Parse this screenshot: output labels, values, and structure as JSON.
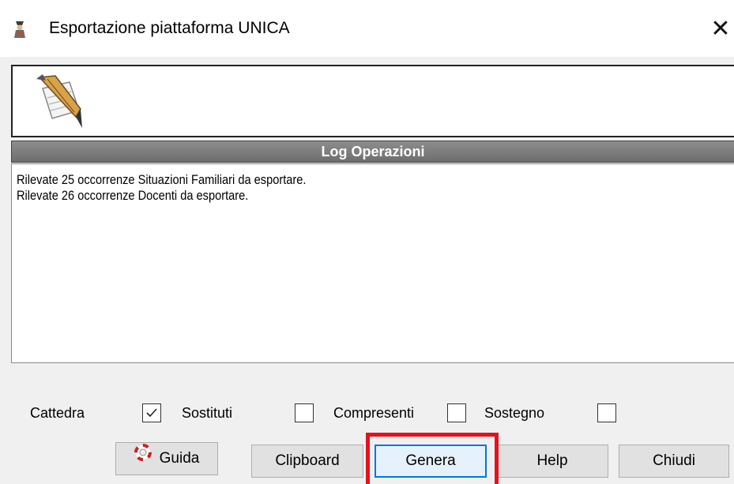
{
  "window": {
    "title": "Esportazione piattaforma UNICA",
    "app_icon": "wizard-figure-icon",
    "close_glyph": "✕"
  },
  "header_panel": {
    "icon": "quill-document-icon"
  },
  "log": {
    "header": "Log Operazioni",
    "lines": [
      "Rilevate 25 occorrenze Situazioni Familiari da esportare.",
      "Rilevate 26 occorrenze Docenti da esportare."
    ]
  },
  "options": [
    {
      "label": "Cattedra",
      "checked": true
    },
    {
      "label": "Sostituti",
      "checked": false
    },
    {
      "label": "Compresenti",
      "checked": false
    },
    {
      "label": "Sostegno",
      "checked": false
    }
  ],
  "buttons": {
    "guida": {
      "label": "Guida",
      "icon": "lifebuoy-icon"
    },
    "clipboard": {
      "label": "Clipboard"
    },
    "genera": {
      "label": "Genera"
    },
    "help": {
      "label": "Help"
    },
    "chiudi": {
      "label": "Chiudi"
    }
  },
  "colors": {
    "highlight": "#e3121f",
    "focus": "#0078d7",
    "log_header_bg": "#7a7a7a"
  }
}
